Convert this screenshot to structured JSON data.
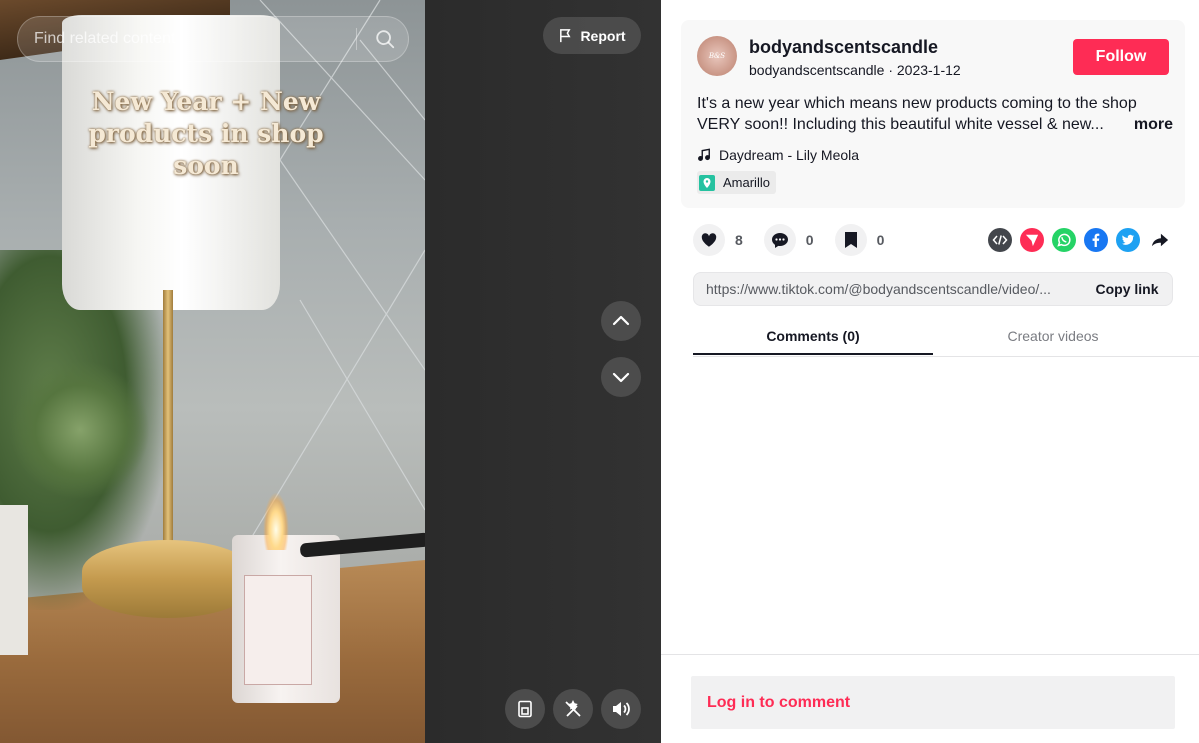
{
  "video": {
    "overlay_caption": "New Year + New products in shop soon",
    "search_placeholder": "Find related content",
    "report_label": "Report"
  },
  "author": {
    "username": "bodyandscentscandle",
    "subline": "bodyandscentscandle · 2023-1-12",
    "follow_label": "Follow"
  },
  "post": {
    "description_line1": "It's a new year which means new products coming to the shop",
    "description_line2": "VERY soon!! Including this beautiful white vessel & new...",
    "more_label": "more",
    "music": "Daydream - Lily Meola",
    "location": "Amarillo"
  },
  "stats": {
    "likes": "8",
    "comments": "0",
    "saves": "0"
  },
  "link": {
    "url": "https://www.tiktok.com/@bodyandscentscandle/video/...",
    "copy_label": "Copy link"
  },
  "tabs": {
    "comments": "Comments (0)",
    "creator_videos": "Creator videos"
  },
  "footer": {
    "login_prompt": "Log in to comment"
  },
  "colors": {
    "accent": "#fe2c55",
    "text": "#161823",
    "muted": "#575a60",
    "whatsapp": "#25d366",
    "facebook": "#1877f2",
    "twitter": "#1da1f2"
  }
}
